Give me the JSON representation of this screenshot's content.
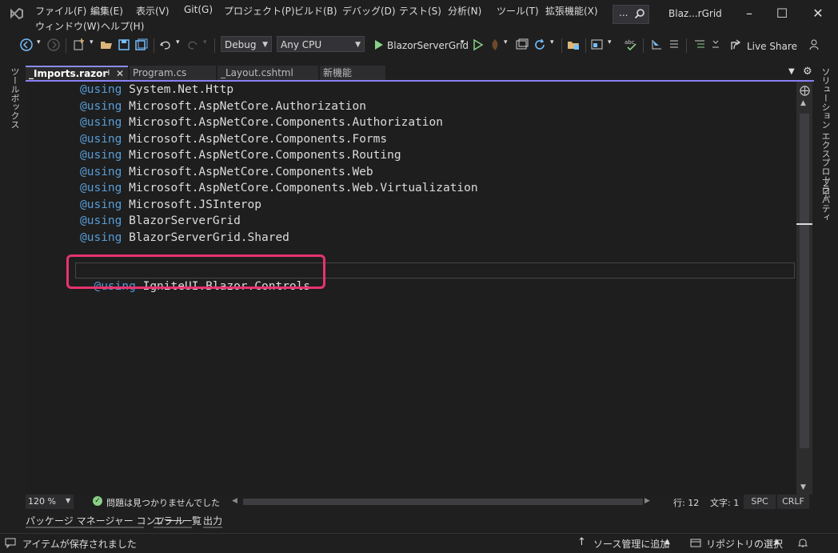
{
  "menu": {
    "items": [
      "ファイル(F)",
      "編集(E)",
      "表示(V)",
      "Git(G)",
      "プロジェクト(P)",
      "ビルド(B)",
      "デバッグ(D)",
      "テスト(S)",
      "分析(N)",
      "ツール(T)",
      "拡張機能(X)"
    ],
    "items_row2": [
      "ウィンドウ(W)",
      "ヘルプ(H)"
    ],
    "search_label": "...",
    "window_title": "Blaz...rGrid"
  },
  "toolbar": {
    "config": "Debug",
    "platform": "Any CPU",
    "run_target": "BlazorServerGrid",
    "live_share": "Live Share"
  },
  "side": {
    "left_label": "ツールボックス",
    "right_labels": [
      "ソリューション エクスプローラー",
      "プロパティ"
    ]
  },
  "tabs": [
    {
      "label": "_Imports.razor",
      "active": true
    },
    {
      "label": "Program.cs",
      "active": false
    },
    {
      "label": "_Layout.cshtml",
      "active": false
    },
    {
      "label": "新機能",
      "active": false
    }
  ],
  "code": {
    "keyword": "@using",
    "lines": [
      "System.Net.Http",
      "Microsoft.AspNetCore.Authorization",
      "Microsoft.AspNetCore.Components.Authorization",
      "Microsoft.AspNetCore.Components.Forms",
      "Microsoft.AspNetCore.Components.Routing",
      "Microsoft.AspNetCore.Components.Web",
      "Microsoft.AspNetCore.Components.Web.Virtualization",
      "Microsoft.JSInterop",
      "BlazorServerGrid",
      "BlazorServerGrid.Shared"
    ],
    "highlighted_line": "IgniteUI.Blazor.Controls"
  },
  "editor_status": {
    "zoom": "120 %",
    "issues": "問題は見つかりませんでした",
    "line": "行: 12",
    "col": "文字: 1",
    "spc": "SPC",
    "eol": "CRLF"
  },
  "bottom_tabs": [
    "パッケージ マネージャー コンソール",
    "エラー一覧",
    "出力"
  ],
  "statusbar": {
    "message": "アイテムが保存されました",
    "source_control": "ソース管理に追加",
    "repository": "リポジトリの選択"
  },
  "colors": {
    "accent": "#8a80f5",
    "highlight": "#e8336d",
    "keyword": "#569cd6"
  }
}
